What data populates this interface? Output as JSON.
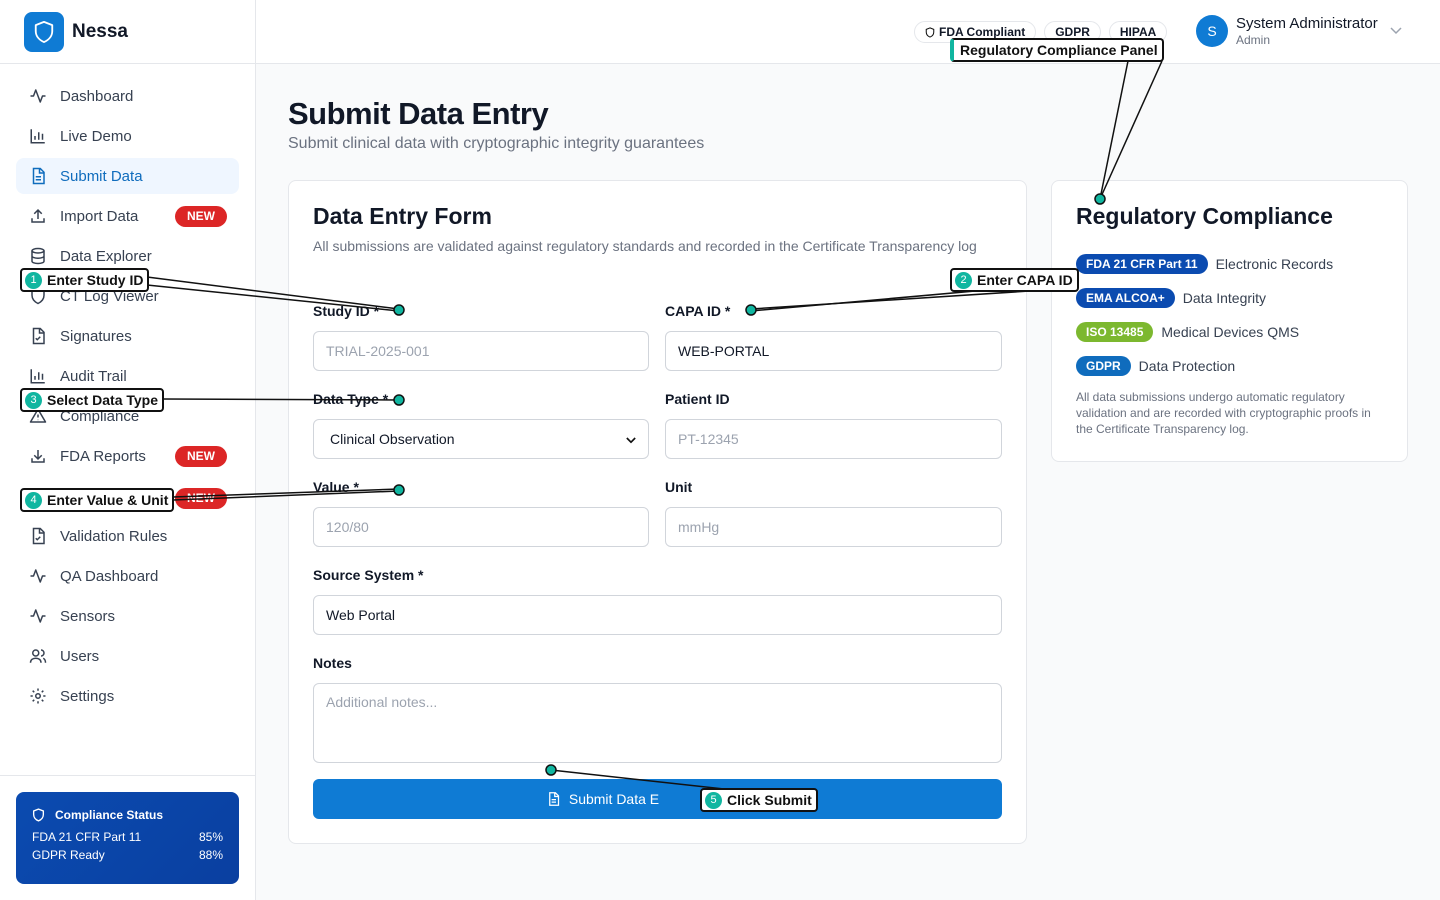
{
  "brand": {
    "name": "Nessa"
  },
  "nav": [
    {
      "label": "Dashboard",
      "icon": "activity-icon"
    },
    {
      "label": "Live Demo",
      "icon": "bar-chart-icon"
    },
    {
      "label": "Submit Data",
      "icon": "file-icon",
      "active": true
    },
    {
      "label": "Import Data",
      "icon": "upload-icon",
      "badge": "NEW"
    },
    {
      "label": "Data Explorer",
      "icon": "database-icon"
    },
    {
      "label": "CT Log Viewer",
      "icon": "shield-icon"
    },
    {
      "label": "Signatures",
      "icon": "file-check-icon"
    },
    {
      "label": "Audit Trail",
      "icon": "bar-chart-icon"
    },
    {
      "label": "Compliance",
      "icon": "warning-icon"
    },
    {
      "label": "FDA Reports",
      "icon": "download-icon",
      "badge": "NEW"
    },
    {
      "label": "",
      "icon": "",
      "badge": "NEW"
    },
    {
      "label": "Validation Rules",
      "icon": "file-check-icon"
    },
    {
      "label": "QA Dashboard",
      "icon": "activity-icon"
    },
    {
      "label": "Sensors",
      "icon": "activity-icon"
    },
    {
      "label": "Users",
      "icon": "users-icon"
    },
    {
      "label": "Settings",
      "icon": "gear-icon"
    }
  ],
  "compliance_status": {
    "title": "Compliance Status",
    "rows": [
      {
        "label": "FDA 21 CFR Part 11",
        "value": "85%"
      },
      {
        "label": "GDPR Ready",
        "value": "88%"
      }
    ]
  },
  "topbar": {
    "pills": [
      "FDA Compliant",
      "GDPR",
      "HIPAA"
    ],
    "user": {
      "initial": "S",
      "name": "System Administrator",
      "role": "Admin"
    }
  },
  "page": {
    "title": "Submit Data Entry",
    "subtitle": "Submit clinical data with cryptographic integrity guarantees"
  },
  "form": {
    "title": "Data Entry Form",
    "description": "All submissions are validated against regulatory standards and recorded in the Certificate Transparency log",
    "study_id": {
      "label": "Study ID *",
      "placeholder": "TRIAL-2025-001"
    },
    "capa_id": {
      "label": "CAPA ID *",
      "value": "WEB-PORTAL"
    },
    "data_type": {
      "label": "Data Type *",
      "value": "Clinical Observation"
    },
    "patient_id": {
      "label": "Patient ID",
      "placeholder": "PT-12345"
    },
    "value": {
      "label": "Value *",
      "placeholder": "120/80"
    },
    "unit": {
      "label": "Unit",
      "placeholder": "mmHg"
    },
    "source_system": {
      "label": "Source System *",
      "value": "Web Portal"
    },
    "notes": {
      "label": "Notes",
      "placeholder": "Additional notes..."
    },
    "submit_label": "Submit Data E"
  },
  "regulatory": {
    "title": "Regulatory Compliance",
    "items": [
      {
        "badge": "FDA 21 CFR Part 11",
        "text": "Electronic Records",
        "color": "#0b4bb0"
      },
      {
        "badge": "EMA ALCOA+",
        "text": "Data Integrity",
        "color": "#0b4bb0"
      },
      {
        "badge": "ISO 13485",
        "text": "Medical Devices QMS",
        "color": "#7cb82f"
      },
      {
        "badge": "GDPR",
        "text": "Data Protection",
        "color": "#0f6cbd"
      }
    ],
    "note": "All data submissions undergo automatic regulatory validation and are recorded with cryptographic proofs in the Certificate Transparency log."
  },
  "annotations": [
    {
      "num": "1",
      "text": "Enter Study ID"
    },
    {
      "num": "2",
      "text": "Enter CAPA ID"
    },
    {
      "num": "3",
      "text": "Select Data Type"
    },
    {
      "num": "4",
      "text": "Enter Value & Unit"
    },
    {
      "num": "5",
      "text": "Click Submit"
    },
    {
      "num": "",
      "text": "Regulatory Compliance Panel"
    }
  ],
  "colors": {
    "primary": "#0f7bd4",
    "new_badge": "#dc2626",
    "annotation_dot": "#10b6a0"
  }
}
